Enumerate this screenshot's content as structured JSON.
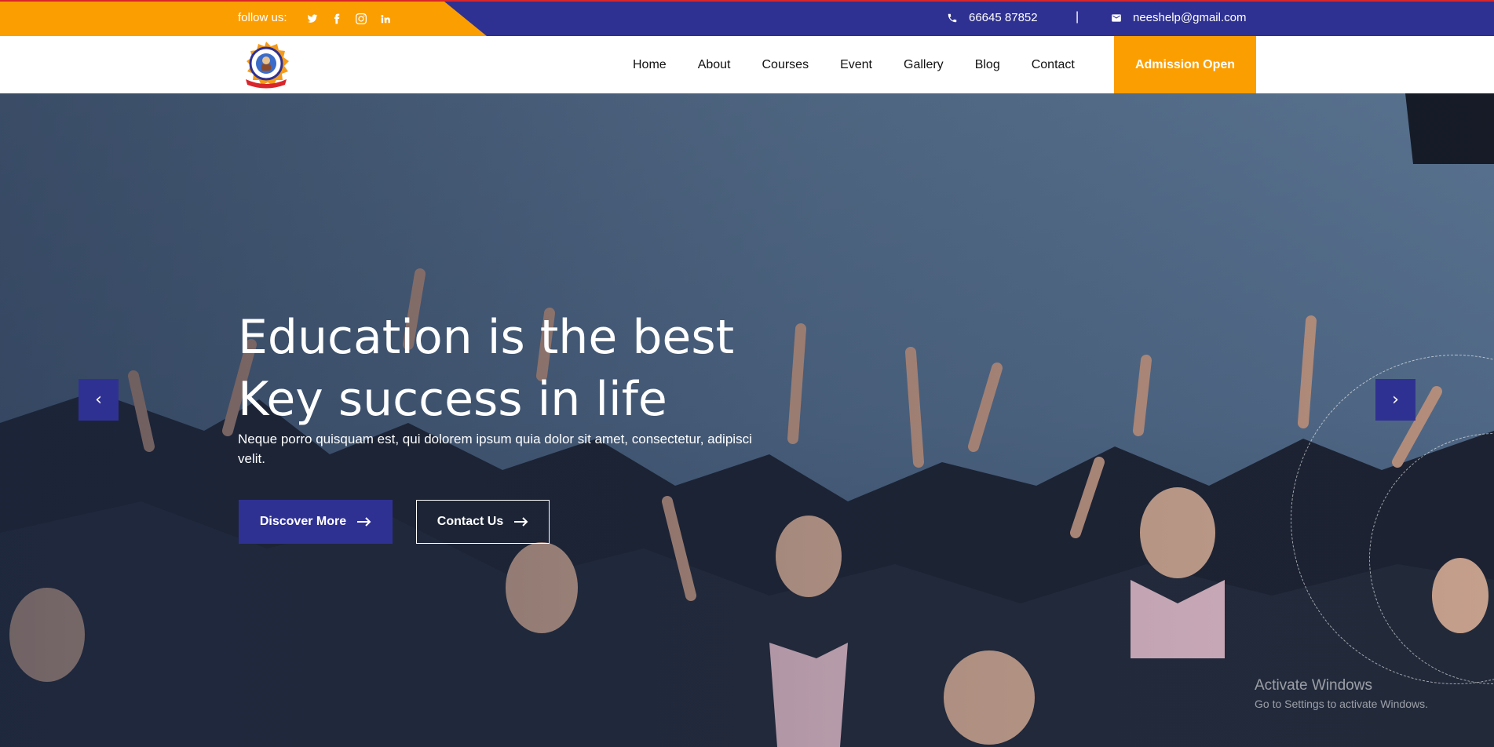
{
  "topbar": {
    "follow_label": "follow us:",
    "social": [
      "twitter-icon",
      "facebook-icon",
      "instagram-icon",
      "linkedin-icon"
    ],
    "phone": "66645 87852",
    "separator": "|",
    "email": "neeshelp@gmail.com"
  },
  "nav": {
    "items": [
      "Home",
      "About",
      "Courses",
      "Event",
      "Gallery",
      "Blog",
      "Contact"
    ],
    "cta": "Admission Open"
  },
  "hero": {
    "title_line1": "Education is the best",
    "title_line2": "Key success in life",
    "text": "Neque porro quisquam est, qui dolorem ipsum quia dolor sit amet, consectetur, adipisci velit.",
    "discover": "Discover More",
    "contact": "Contact Us",
    "prev": "‹",
    "next": "›"
  },
  "watermark": {
    "title": "Activate Windows",
    "subtitle": "Go to Settings to activate Windows."
  },
  "colors": {
    "primary": "#2f3192",
    "accent": "#fb9e02",
    "top_border": "#d8262b"
  }
}
